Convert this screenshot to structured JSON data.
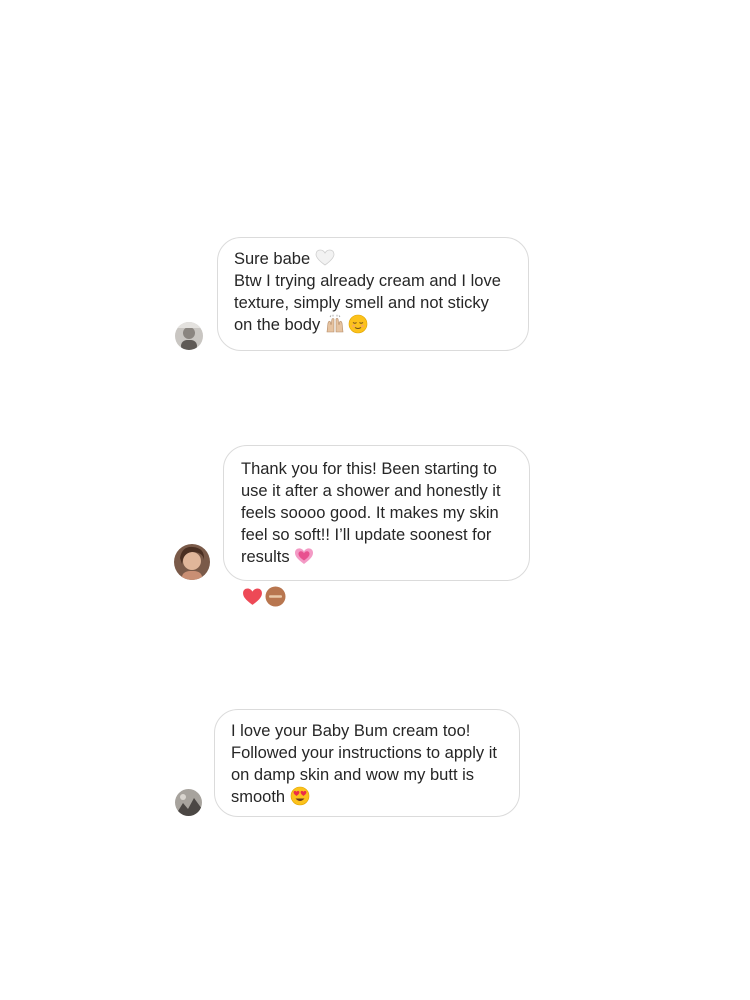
{
  "messages": [
    {
      "lines": [
        "Sure babe",
        "Btw I trying already cream and I love",
        "texture, simply smell and not sticky",
        "on the body"
      ],
      "emojis": [
        "white-heart-icon",
        "raising-hands-icon",
        "relieved-face-icon"
      ]
    },
    {
      "lines": [
        "Thank you for this! Been starting to",
        "use it after a shower and honestly it",
        "feels soooo good. It makes my skin",
        "feel so soft!! I’ll update soonest for",
        "results"
      ],
      "emojis": [
        "growing-heart-icon"
      ],
      "reactions": [
        "red-heart-icon",
        "profile-reaction-icon"
      ]
    },
    {
      "lines": [
        "I love your Baby Bum cream too!",
        "Followed your instructions to apply it",
        "on damp skin and wow my butt is",
        "smooth"
      ],
      "emojis": [
        "heart-eyes-face-icon"
      ]
    }
  ],
  "colors": {
    "bubble_border": "#dbdbdb",
    "text": "#262626",
    "heart": "#ed4956",
    "pink_heart": "#e8508f"
  }
}
